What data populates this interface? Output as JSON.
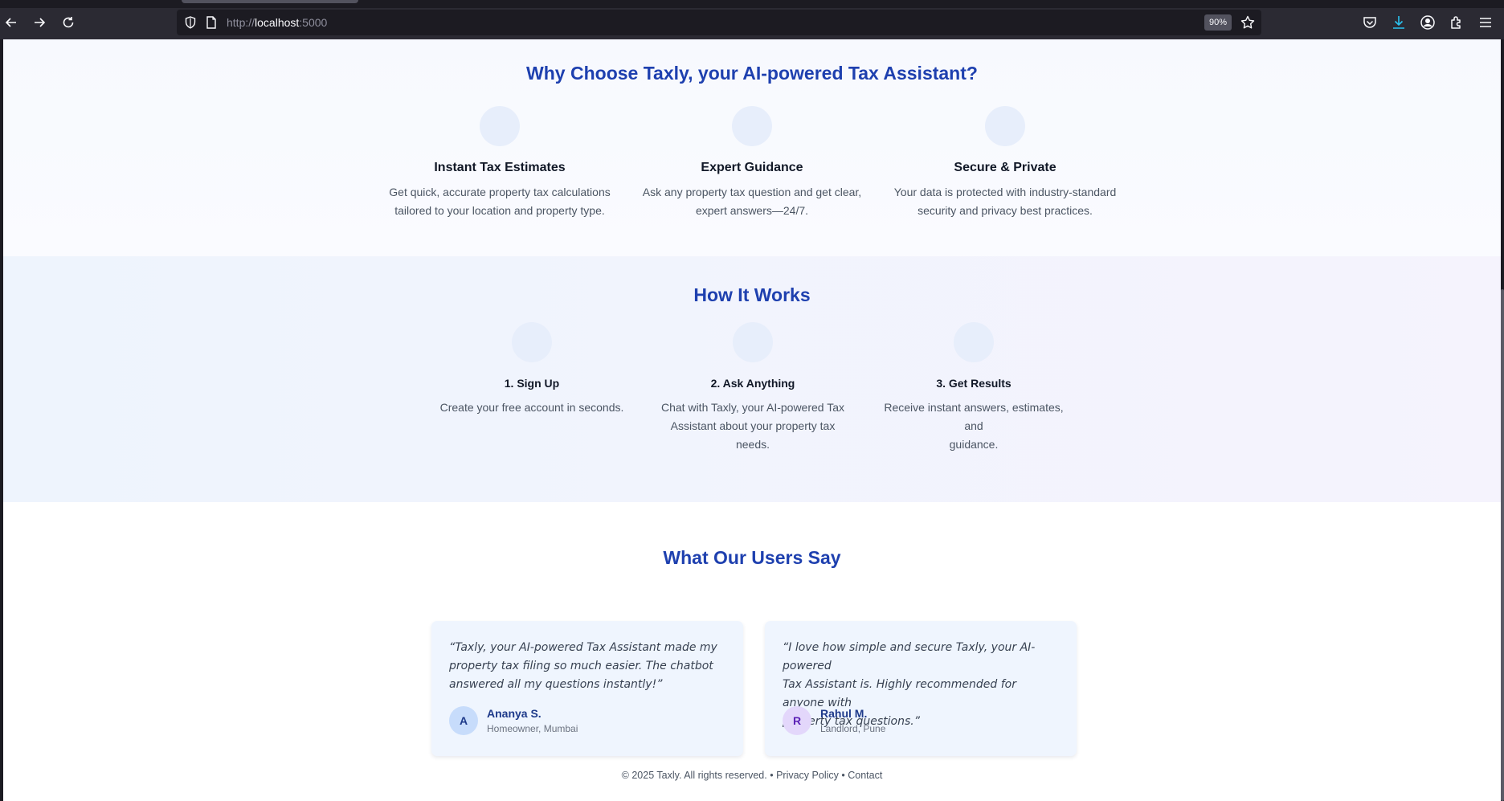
{
  "browser": {
    "url_prefix": "http://",
    "url_host": "localhost",
    "url_suffix": ":5000",
    "zoom": "90%"
  },
  "features": {
    "heading": "Why Choose Taxly, your AI-powered Tax Assistant?",
    "items": [
      {
        "title": "Instant Tax Estimates",
        "line1": "Get quick, accurate property tax calculations",
        "line2": "tailored to your location and property type."
      },
      {
        "title": "Expert Guidance",
        "line1": "Ask any property tax question and get clear,",
        "line2": "expert answers—24/7."
      },
      {
        "title": "Secure & Private",
        "line1": "Your data is protected with industry-standard",
        "line2": "security and privacy best practices."
      }
    ]
  },
  "how": {
    "heading": "How It Works",
    "steps": [
      {
        "title": "1. Sign Up",
        "lines": [
          "Create your free account in seconds.",
          "",
          ""
        ]
      },
      {
        "title": "2. Ask Anything",
        "lines": [
          "Chat with Taxly, your AI-powered Tax",
          "Assistant about your property tax",
          "needs."
        ]
      },
      {
        "title": "3. Get Results",
        "lines": [
          "Receive instant answers, estimates, and",
          "guidance.",
          ""
        ]
      }
    ]
  },
  "testimonials": {
    "heading": "What Our Users Say",
    "items": [
      {
        "lines": [
          "“Taxly, your AI-powered Tax Assistant made my",
          "property tax filing so much easier. The chatbot",
          "answered all my questions instantly!”"
        ],
        "initial": "A",
        "name": "Ananya S.",
        "role": "Homeowner, Mumbai",
        "avatar_bg": "#c7dcfb",
        "avatar_fg": "#1e3a8a"
      },
      {
        "lines": [
          "“I love how simple and secure Taxly, your AI-powered",
          "Tax Assistant is. Highly recommended for anyone with",
          "property tax questions.”"
        ],
        "initial": "R",
        "name": "Rahul M.",
        "role": "Landlord, Pune",
        "avatar_bg": "#e3d7fb",
        "avatar_fg": "#5b21b6"
      }
    ]
  },
  "footer": {
    "copyright": "© 2025 Taxly. All rights reserved.",
    "sep1": "•",
    "privacy": "Privacy Policy",
    "sep2": "•",
    "contact": "Contact"
  },
  "colors": {
    "heading": "#1e40af",
    "chrome": "#2b2a33"
  }
}
